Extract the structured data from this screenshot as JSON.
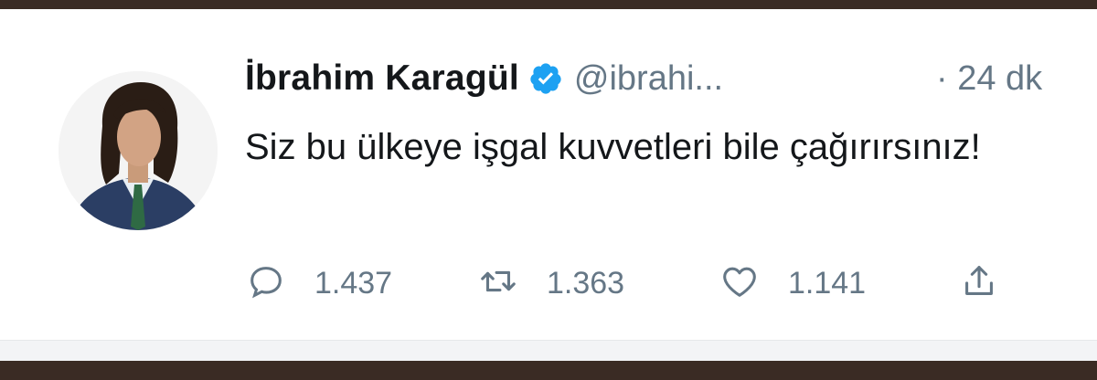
{
  "tweet": {
    "author_name": "İbrahim Karagül",
    "handle": "@ibrahi...",
    "time": "· 24 dk",
    "text": "Siz bu ülkeye işgal kuvvetleri bile çağırırsınız!",
    "verified_icon": "verified-badge-icon",
    "accent_color": "#1da1f2"
  },
  "actions": {
    "reply": {
      "icon": "reply-icon",
      "count": "1.437"
    },
    "retweet": {
      "icon": "retweet-icon",
      "count": "1.363"
    },
    "like": {
      "icon": "heart-icon",
      "count": "1.141"
    },
    "share": {
      "icon": "share-icon"
    }
  }
}
